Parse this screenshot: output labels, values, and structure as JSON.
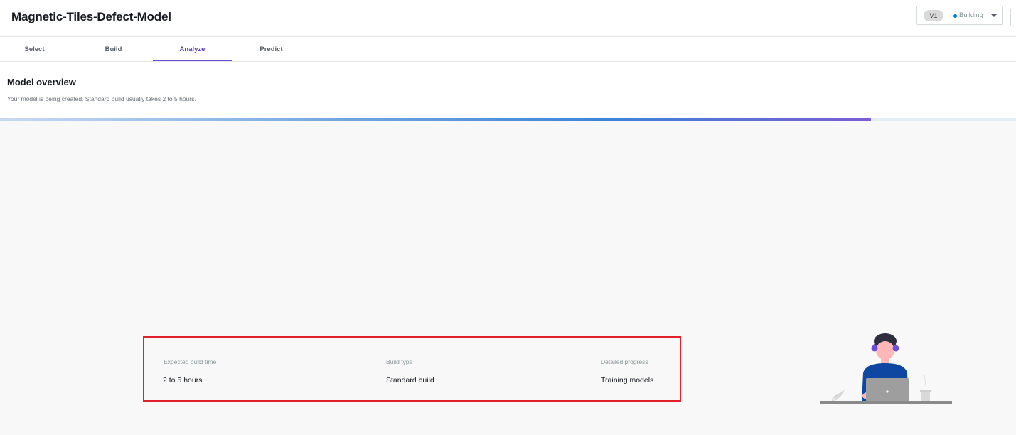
{
  "header": {
    "title": "Magnetic-Tiles-Defect-Model",
    "version": {
      "label": "V1",
      "status": "Building",
      "status_color": "#0972d3"
    }
  },
  "tabs": [
    {
      "label": "Select",
      "active": false
    },
    {
      "label": "Build",
      "active": false
    },
    {
      "label": "Analyze",
      "active": true
    },
    {
      "label": "Predict",
      "active": false
    }
  ],
  "overview": {
    "title": "Model overview",
    "description": "Your model is being created. Standard build usually takes 2 to 5 hours.",
    "progress_fraction": 0.857
  },
  "build_info": {
    "expected_time": {
      "label": "Expected build time",
      "value": "2 to 5 hours"
    },
    "build_type": {
      "label": "Build type",
      "value": "Standard build"
    },
    "progress": {
      "label": "Detailed progress",
      "value": "Training models"
    }
  },
  "colors": {
    "accent": "#6b4ed8",
    "highlight_border": "#e1202a",
    "background": "#f8f8f8"
  },
  "icons": [
    "chevron-down-icon",
    "person-at-laptop-illustration"
  ]
}
